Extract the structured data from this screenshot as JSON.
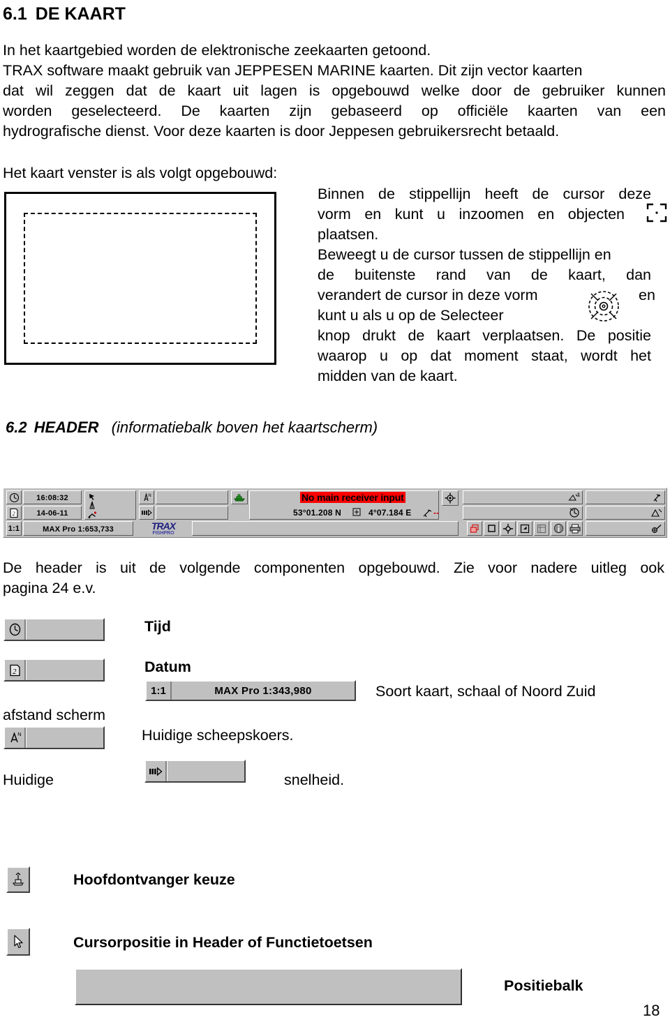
{
  "section_61": {
    "number": "6.1",
    "title": "DE KAART",
    "para1_line1": "In het kaartgebied worden de elektronische zeekaarten getoond.",
    "para1_line2": "TRAX software maakt gebruik van JEPPESEN MARINE kaarten. Dit zijn vector kaarten",
    "para1_line3": "dat wil zeggen dat de kaart uit lagen is opgebouwd welke door de gebruiker kunnen",
    "para1_line4": "worden geselecteerd. De kaarten zijn gebaseerd op officiële kaarten van een",
    "para1_line5": "hydrografische dienst. Voor deze kaarten is door Jeppesen gebruikersrecht  betaald.",
    "figure_intro": "Het kaart venster is als volgt opgebouwd:",
    "side_line1": "Binnen de stippellijn heeft de cursor deze",
    "side_line2": "vorm en kunt u inzoomen en objecten",
    "side_line3": "plaatsen.",
    "side_line4": "Beweegt u de cursor tussen de stippellijn en",
    "side_line5": "de buitenste rand van de kaart, dan",
    "side_line6": "verandert de cursor in deze vorm",
    "side_line6b": "en",
    "side_line7": "kunt u als u op de Selecteer",
    "side_line8": "knop drukt de kaart verplaatsen. De positie",
    "side_line9": "waarop u op dat moment staat, wordt het",
    "side_line10": "midden van de kaart."
  },
  "section_62": {
    "number": "6.2",
    "title": "HEADER",
    "subtitle": "(informatiebalk boven het kaartscherm)",
    "para_line1": "De header is uit de volgende componenten opgebouwd. Zie voor nadere uitleg ook",
    "para_line2": "pagina 24 e.v."
  },
  "header_bar": {
    "time": "16:08:32",
    "date": "14-06-11",
    "ratio": "1:1",
    "chart_scale": "MAX Pro   1:653,733",
    "alarm_text": "No main receiver input",
    "latitude": "53°01.208 N",
    "longitude": "4°07.184 E",
    "dash": "--",
    "logo_top": "TRAX",
    "logo_bottom": "FISHPRO",
    "icons": {
      "clock": "clock-icon",
      "calendar": "calendar-icon",
      "cursor_arrow": "cursor-arrow-icon",
      "anchor": "anchor-icon",
      "track": "track-icon",
      "compass": "compass-north-icon",
      "speed": "speed-icon",
      "boat": "boat-icon",
      "position_marker": "position-marker-icon",
      "target": "target-crosshair-icon",
      "waypoint1": "waypoint-1-icon",
      "route": "route-icon",
      "layers": "layers-icon",
      "square": "square-icon",
      "center": "center-crosshair-icon",
      "zoombox": "zoom-box-icon",
      "grid": "grid-icon",
      "info": "info-icon",
      "print": "print-icon",
      "divider": "divider-icon",
      "triangle": "triangle-measure-icon",
      "nav": "nav-tool-icon"
    }
  },
  "legend": {
    "tijd": "Tijd",
    "datum": "Datum",
    "scale_ratio": "1:1",
    "scale_value": "MAX Pro   1:343,980",
    "soort_kaart": "Soort  kaart,  schaal  of  Noord  Zuid",
    "afstand_scherm": "afstand scherm",
    "huidige_scheepskoers": "Huidige scheepskoers.",
    "huidige": "Huidige",
    "snelheid": "snelheid.",
    "hoofdontvanger": "Hoofdontvanger keuze",
    "cursorpositie": "Cursorpositie in Header of Functietoetsen",
    "positiebalk": "Positiebalk",
    "icons": {
      "clock": "clock-icon",
      "calendar": "calendar-icon",
      "compass": "compass-north-icon",
      "speed": "speed-icon",
      "receiver": "receiver-antenna-icon",
      "pointer": "mouse-pointer-icon"
    }
  },
  "footer": {
    "page_number": "18"
  },
  "colors": {
    "alarm_bg": "#ff0000",
    "toolbar_bg": "#c0c0c0",
    "logo_blue": "#202080"
  }
}
